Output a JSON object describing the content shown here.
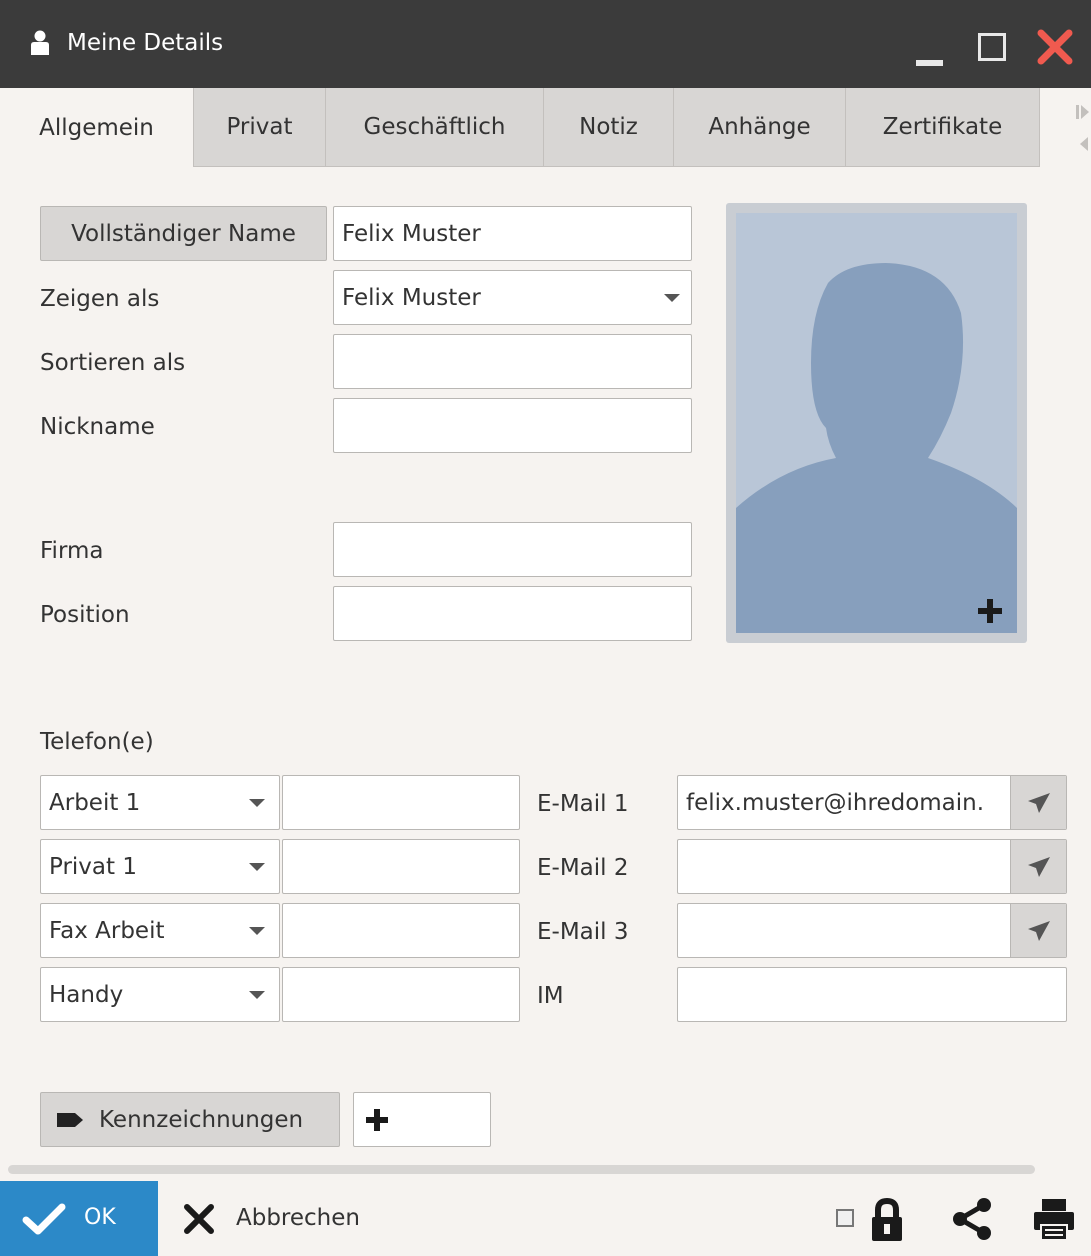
{
  "window": {
    "title": "Meine Details"
  },
  "tabs": [
    {
      "label": "Allgemein",
      "active": true
    },
    {
      "label": "Privat"
    },
    {
      "label": "Geschäftlich"
    },
    {
      "label": "Notiz"
    },
    {
      "label": "Anhänge"
    },
    {
      "label": "Zertifikate"
    }
  ],
  "form": {
    "full_name_button": "Vollständiger Name",
    "full_name_value": "Felix Muster",
    "display_as_label": "Zeigen als",
    "display_as_value": "Felix Muster",
    "sort_as_label": "Sortieren als",
    "sort_as_value": "",
    "nickname_label": "Nickname",
    "nickname_value": "",
    "company_label": "Firma",
    "company_value": "",
    "position_label": "Position",
    "position_value": ""
  },
  "phones": {
    "header": "Telefon(e)",
    "rows": [
      {
        "type": "Arbeit 1",
        "value": ""
      },
      {
        "type": "Privat 1",
        "value": ""
      },
      {
        "type": "Fax Arbeit",
        "value": ""
      },
      {
        "type": "Handy",
        "value": ""
      }
    ]
  },
  "emails": [
    {
      "label": "E-Mail 1",
      "value": "felix.muster@ihredomain."
    },
    {
      "label": "E-Mail 2",
      "value": ""
    },
    {
      "label": "E-Mail 3",
      "value": ""
    },
    {
      "label": "IM",
      "value": ""
    }
  ],
  "tags": {
    "button_label": "Kennzeichnungen",
    "add_symbol": "+"
  },
  "footer": {
    "ok_label": "OK",
    "cancel_label": "Abbrechen"
  },
  "colors": {
    "titlebar": "#3b3b3b",
    "close": "#f05a4f",
    "ok": "#2c89c8",
    "background": "#f6f3f0"
  },
  "icons": [
    "user-icon",
    "minimize-icon",
    "maximize-icon",
    "close-icon",
    "dropdown-caret-icon",
    "send-icon",
    "add-photo-icon",
    "tag-icon",
    "plus-icon",
    "checkmark-icon",
    "x-icon",
    "lock-icon",
    "share-icon",
    "print-icon"
  ]
}
